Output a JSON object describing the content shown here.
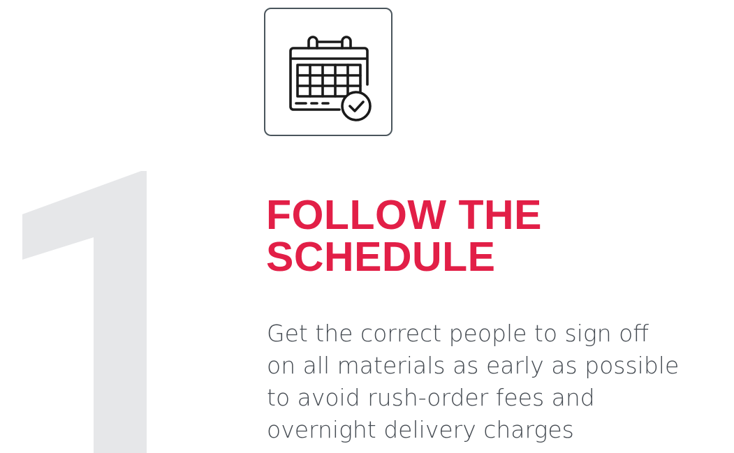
{
  "step": {
    "number": "1",
    "icon": "calendar-check-icon",
    "title_lines": [
      "FOLLOW THE",
      "SCHEDULE"
    ],
    "body_lines": [
      "Get the correct people to sign off",
      "on all materials as early as possible",
      "to avoid rush-order fees and",
      "overnight delivery charges"
    ]
  },
  "colors": {
    "accent": "#e21f47",
    "numeral": "#e6e7e9",
    "text": "#454b52",
    "icon_border": "#4a555c",
    "icon_stroke": "#1a1a1a"
  }
}
